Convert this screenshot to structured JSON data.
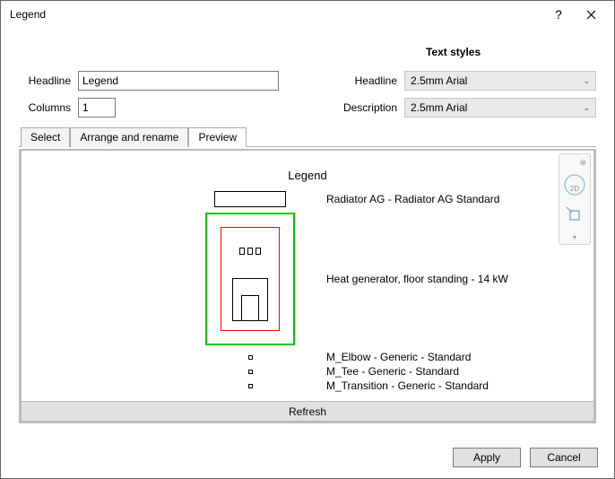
{
  "titlebar": {
    "title": "Legend"
  },
  "form": {
    "headline_label": "Headline",
    "headline_value": "Legend",
    "columns_label": "Columns",
    "columns_value": "1",
    "textstyles_label": "Text styles",
    "ts_headline_label": "Headline",
    "ts_headline_value": "2.5mm Arial",
    "ts_desc_label": "Description",
    "ts_desc_value": "2.5mm Arial"
  },
  "tabs": {
    "select": "Select",
    "arrange": "Arrange and rename",
    "preview": "Preview"
  },
  "preview": {
    "title": "Legend",
    "items": [
      "Radiator AG - Radiator AG Standard",
      "Heat generator, floor standing - 14 kW",
      "M_Elbow - Generic - Standard",
      "M_Tee - Generic - Standard",
      "M_Transition - Generic - Standard"
    ],
    "refresh_label": "Refresh"
  },
  "navcube": {
    "mode": "2D"
  },
  "footer": {
    "apply": "Apply",
    "cancel": "Cancel"
  }
}
